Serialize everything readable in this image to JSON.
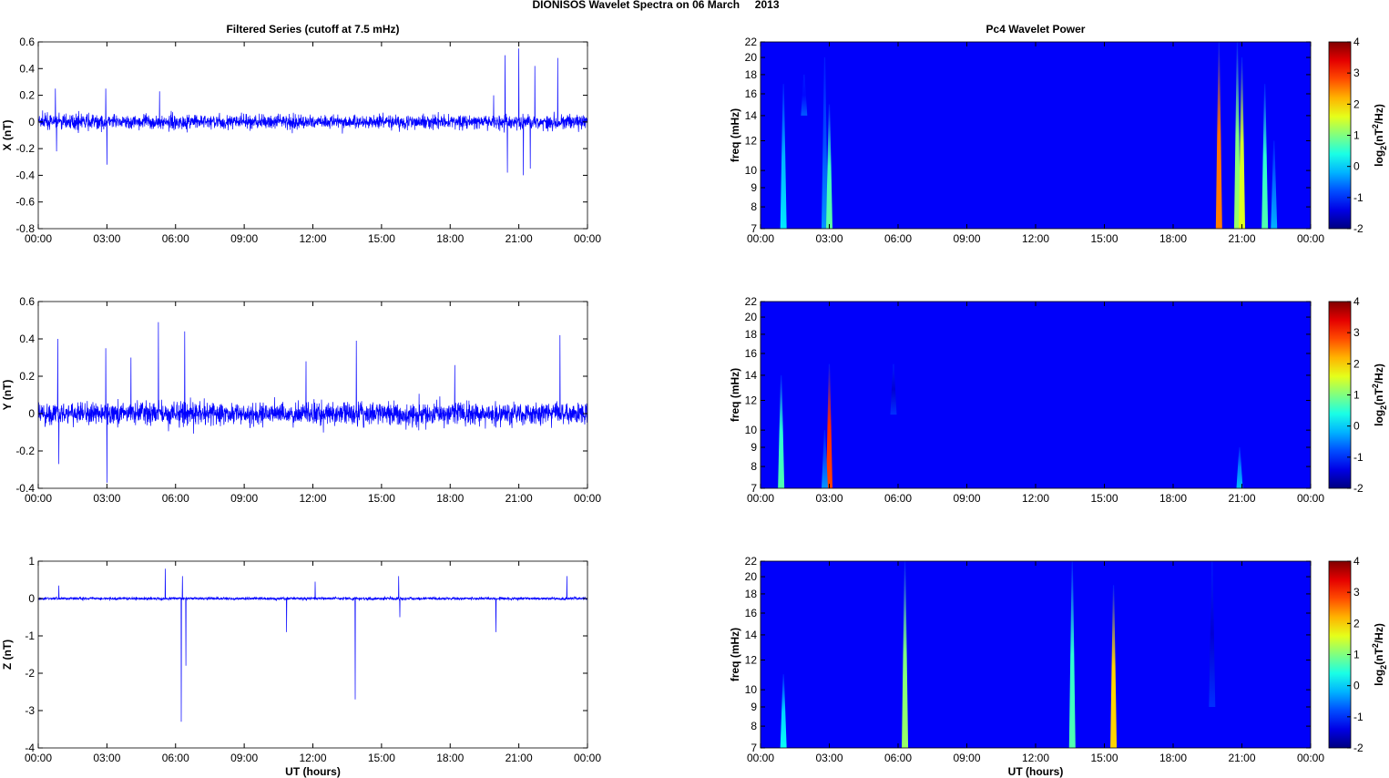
{
  "title": "DIONISOS Wavelet Spectra on 06 March     2013",
  "colors": {
    "trace": "#0000ff",
    "axis": "#000000"
  },
  "chart_data": [
    {
      "type": "line",
      "title": "Filtered Series (cutoff at 7.5 mHz)",
      "ylabel": "X (nT)",
      "xlabel": "",
      "xlim": [
        0,
        24
      ],
      "ylim": [
        -0.8,
        0.6
      ],
      "yticks": [
        "-0.8",
        "-0.6",
        "-0.4",
        "-0.2",
        "0",
        "0.2",
        "0.4",
        "0.6"
      ],
      "xticks": [
        "00:00",
        "03:00",
        "06:00",
        "09:00",
        "12:00",
        "15:00",
        "18:00",
        "21:00",
        "00:00"
      ],
      "noise_amplitude": 0.07,
      "spikes": [
        [
          0.75,
          0.25
        ],
        [
          0.8,
          -0.22
        ],
        [
          2.95,
          0.25
        ],
        [
          3.0,
          -0.32
        ],
        [
          5.3,
          0.23
        ],
        [
          20.4,
          0.5
        ],
        [
          20.5,
          -0.38
        ],
        [
          21.0,
          0.55
        ],
        [
          21.2,
          -0.4
        ],
        [
          21.7,
          0.42
        ],
        [
          22.7,
          0.48
        ],
        [
          19.9,
          0.2
        ],
        [
          21.5,
          -0.35
        ]
      ]
    },
    {
      "type": "line",
      "title": "",
      "ylabel": "Y (nT)",
      "xlabel": "",
      "xlim": [
        0,
        24
      ],
      "ylim": [
        -0.4,
        0.6
      ],
      "yticks": [
        "-0.4",
        "-0.2",
        "0",
        "0.2",
        "0.4",
        "0.6"
      ],
      "xticks": [
        "00:00",
        "03:00",
        "06:00",
        "09:00",
        "12:00",
        "15:00",
        "18:00",
        "21:00",
        "00:00"
      ],
      "noise_amplitude": 0.08,
      "spikes": [
        [
          0.85,
          0.4
        ],
        [
          0.9,
          -0.27
        ],
        [
          2.95,
          0.35
        ],
        [
          3.0,
          -0.37
        ],
        [
          5.25,
          0.49
        ],
        [
          6.4,
          0.44
        ],
        [
          13.9,
          0.39
        ],
        [
          22.8,
          0.42
        ],
        [
          4.05,
          0.3
        ],
        [
          18.2,
          0.26
        ],
        [
          11.7,
          0.28
        ]
      ]
    },
    {
      "type": "line",
      "title": "",
      "ylabel": "Z (nT)",
      "xlabel": "UT (hours)",
      "xlim": [
        0,
        24
      ],
      "ylim": [
        -4,
        1
      ],
      "yticks": [
        "-4",
        "-3",
        "-2",
        "-1",
        "0",
        "1"
      ],
      "xticks": [
        "00:00",
        "03:00",
        "06:00",
        "09:00",
        "12:00",
        "15:00",
        "18:00",
        "21:00",
        "00:00"
      ],
      "noise_amplitude": 0.05,
      "spikes": [
        [
          6.25,
          -3.3
        ],
        [
          6.45,
          -1.8
        ],
        [
          5.55,
          0.8
        ],
        [
          6.3,
          0.6
        ],
        [
          10.85,
          -0.9
        ],
        [
          13.85,
          -2.7
        ],
        [
          15.75,
          0.6
        ],
        [
          15.8,
          -0.5
        ],
        [
          20.0,
          -0.9
        ],
        [
          23.1,
          0.6
        ],
        [
          0.9,
          0.35
        ],
        [
          12.1,
          0.45
        ]
      ]
    },
    {
      "type": "heatmap",
      "title": "Pc4 Wavelet Power",
      "ylabel": "freq (mHz)",
      "xlabel": "",
      "xlim": [
        0,
        24
      ],
      "ylim": [
        7,
        22
      ],
      "yscale": "log",
      "yticks": [
        "7",
        "8",
        "9",
        "10",
        "12",
        "14",
        "16",
        "18",
        "20",
        "22"
      ],
      "xticks": [
        "00:00",
        "03:00",
        "06:00",
        "09:00",
        "12:00",
        "15:00",
        "18:00",
        "21:00",
        "00:00"
      ],
      "clim": [
        -2,
        4
      ],
      "cbar_ticks": [
        "-2",
        "-1",
        "0",
        "1",
        "2",
        "3",
        "4"
      ],
      "bursts": [
        [
          1.0,
          7,
          17,
          -0.2
        ],
        [
          2.8,
          7,
          20,
          -0.8
        ],
        [
          3.0,
          7,
          15,
          0.6
        ],
        [
          20.0,
          7,
          22,
          2.6
        ],
        [
          20.8,
          7,
          22,
          1.0
        ],
        [
          21.0,
          7,
          20,
          1.5
        ],
        [
          22.0,
          7,
          17,
          0.5
        ],
        [
          22.4,
          7,
          12,
          -0.6
        ],
        [
          1.9,
          14,
          18,
          -1.2
        ]
      ]
    },
    {
      "type": "heatmap",
      "title": "",
      "ylabel": "freq (mHz)",
      "xlabel": "",
      "xlim": [
        0,
        24
      ],
      "ylim": [
        7,
        22
      ],
      "yscale": "log",
      "yticks": [
        "7",
        "8",
        "9",
        "10",
        "12",
        "14",
        "16",
        "18",
        "20",
        "22"
      ],
      "xticks": [
        "00:00",
        "03:00",
        "06:00",
        "09:00",
        "12:00",
        "15:00",
        "18:00",
        "21:00",
        "00:00"
      ],
      "clim": [
        -2,
        4
      ],
      "cbar_ticks": [
        "-2",
        "-1",
        "0",
        "1",
        "2",
        "3",
        "4"
      ],
      "bursts": [
        [
          0.9,
          7,
          14,
          0.5
        ],
        [
          3.0,
          7,
          15,
          3.0
        ],
        [
          2.8,
          7,
          10,
          -0.8
        ],
        [
          20.9,
          7,
          9,
          -0.5
        ],
        [
          5.8,
          11,
          15,
          -1.5
        ]
      ]
    },
    {
      "type": "heatmap",
      "title": "",
      "ylabel": "freq (mHz)",
      "xlabel": "UT (hours)",
      "xlim": [
        0,
        24
      ],
      "ylim": [
        7,
        22
      ],
      "yscale": "log",
      "yticks": [
        "7",
        "8",
        "9",
        "10",
        "12",
        "14",
        "16",
        "18",
        "20",
        "22"
      ],
      "xticks": [
        "00:00",
        "03:00",
        "06:00",
        "09:00",
        "12:00",
        "15:00",
        "18:00",
        "21:00",
        "00:00"
      ],
      "clim": [
        -2,
        4
      ],
      "cbar_ticks": [
        "-2",
        "-1",
        "0",
        "1",
        "2",
        "3",
        "4"
      ],
      "bursts": [
        [
          1.0,
          7,
          11,
          0.0
        ],
        [
          6.3,
          7,
          22,
          1.0
        ],
        [
          13.6,
          7,
          22,
          0.5
        ],
        [
          15.4,
          7,
          19,
          2.0
        ],
        [
          19.7,
          9,
          22,
          -1.5
        ]
      ]
    }
  ],
  "colorbar_label": {
    "base": "log",
    "sub": "2",
    "open": "(nT",
    "sup": "2",
    "close": "/Hz)"
  }
}
